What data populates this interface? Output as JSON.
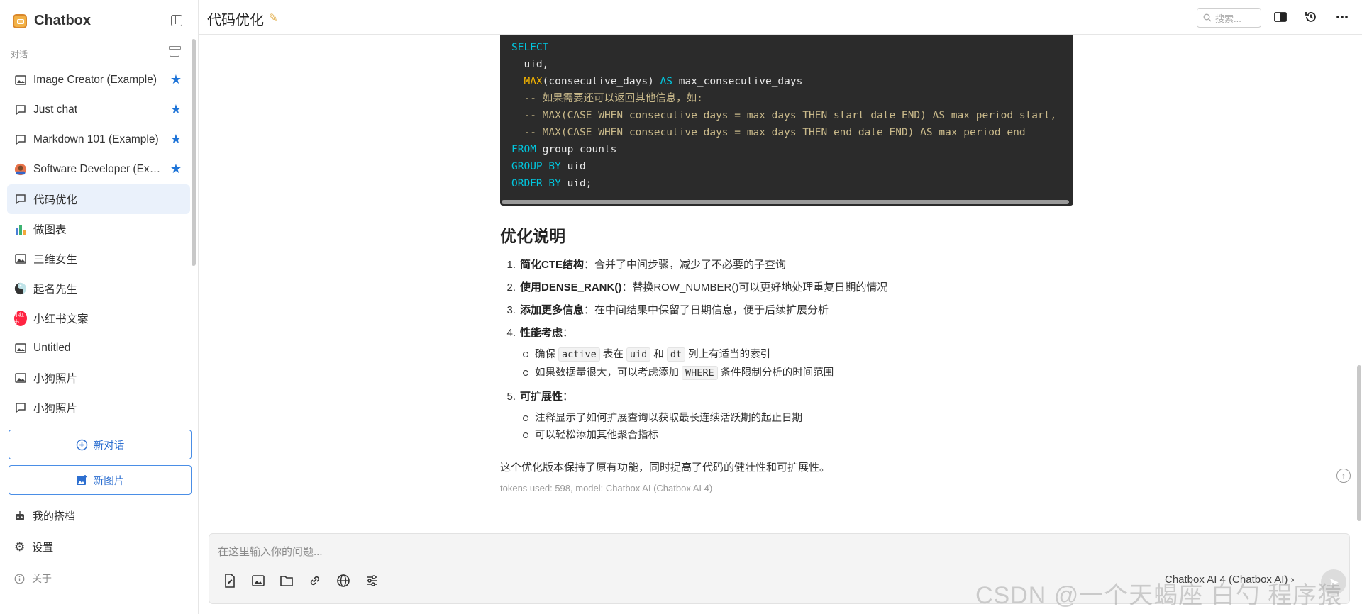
{
  "app": {
    "name": "Chatbox"
  },
  "sidebar": {
    "section_label": "对话",
    "items": [
      {
        "label": "Image Creator (Example)",
        "icon": "image-icon",
        "starred": true
      },
      {
        "label": "Just chat",
        "icon": "chat-icon",
        "starred": true
      },
      {
        "label": "Markdown 101 (Example)",
        "icon": "chat-icon",
        "starred": true
      },
      {
        "label": "Software Developer (Example)",
        "icon": "avatar-developer-icon",
        "starred": true
      },
      {
        "label": "代码优化",
        "icon": "chat-icon",
        "starred": false,
        "active": true
      },
      {
        "label": "做图表",
        "icon": "bar-chart-icon",
        "starred": false
      },
      {
        "label": "三维女生",
        "icon": "image-icon",
        "starred": false
      },
      {
        "label": "起名先生",
        "icon": "avatar-naming-icon",
        "starred": false
      },
      {
        "label": "小红书文案",
        "icon": "xiaohongshu-icon",
        "starred": false
      },
      {
        "label": "Untitled",
        "icon": "image-icon",
        "starred": false
      },
      {
        "label": "小狗照片",
        "icon": "image-icon",
        "starred": false
      },
      {
        "label": "小狗照片",
        "icon": "chat-icon",
        "starred": false
      }
    ],
    "new_chat": "新对话",
    "new_image": "新图片",
    "my_copilots": "我的搭档",
    "settings": "设置",
    "about": "关于",
    "xiaohongshu_badge": "小红书"
  },
  "header": {
    "title": "代码优化",
    "search_placeholder": "搜索..."
  },
  "code": {
    "lines": [
      [
        {
          "t": "SELECT",
          "c": "kw"
        }
      ],
      [
        {
          "t": "  uid,",
          "c": ""
        }
      ],
      [
        {
          "t": "  ",
          "c": ""
        },
        {
          "t": "MAX",
          "c": "fn"
        },
        {
          "t": "(consecutive_days) ",
          "c": ""
        },
        {
          "t": "AS",
          "c": "kw"
        },
        {
          "t": " max_consecutive_days",
          "c": ""
        }
      ],
      [
        {
          "t": "  -- 如果需要还可以返回其他信息，如:",
          "c": "cm"
        }
      ],
      [
        {
          "t": "  -- MAX(CASE WHEN consecutive_days = max_days THEN start_date END) AS max_period_start,",
          "c": "cm"
        }
      ],
      [
        {
          "t": "  -- MAX(CASE WHEN consecutive_days = max_days THEN end_date END) AS max_period_end",
          "c": "cm"
        }
      ],
      [
        {
          "t": "FROM",
          "c": "kw"
        },
        {
          "t": " group_counts",
          "c": ""
        }
      ],
      [
        {
          "t": "GROUP BY",
          "c": "kw"
        },
        {
          "t": " uid",
          "c": ""
        }
      ],
      [
        {
          "t": "ORDER BY",
          "c": "kw"
        },
        {
          "t": " uid;",
          "c": ""
        }
      ]
    ]
  },
  "message": {
    "section_title": "优化说明",
    "items": [
      {
        "num": "1.",
        "bold": "简化CTE结构",
        "text": "：合并了中间步骤，减少了不必要的子查询"
      },
      {
        "num": "2.",
        "bold": "使用DENSE_RANK()",
        "text": "：替换ROW_NUMBER()可以更好地处理重复日期的情况"
      },
      {
        "num": "3.",
        "bold": "添加更多信息",
        "text": "：在中间结果中保留了日期信息，便于后续扩展分析"
      },
      {
        "num": "4.",
        "bold": "性能考虑",
        "text": "："
      },
      {
        "num": "5.",
        "bold": "可扩展性",
        "text": "："
      }
    ],
    "perf": {
      "a1": "确保 ",
      "c1": "active",
      "a2": " 表在 ",
      "c2": "uid",
      "a3": " 和 ",
      "c3": "dt",
      "a4": " 列上有适当的索引",
      "b1": "如果数据量很大，可以考虑添加 ",
      "c4": "WHERE",
      "b2": " 条件限制分析的时间范围"
    },
    "ext": [
      "注释显示了如何扩展查询以获取最长连续活跃期的起止日期",
      "可以轻松添加其他聚合指标"
    ],
    "summary": "这个优化版本保持了原有功能，同时提高了代码的健壮性和可扩展性。",
    "meta": "tokens used: 598, model: Chatbox AI (Chatbox AI 4)"
  },
  "composer": {
    "placeholder": "在这里输入你的问题...",
    "model": "Chatbox AI 4 (Chatbox AI)",
    "model_suffix": "›"
  },
  "watermark": "CSDN @一个天蝎座 白勺 程序猿",
  "colors": {
    "accent": "#1e74d8",
    "code_bg": "#2b2b2b",
    "keyword": "#00c8e0",
    "function": "#f4b400",
    "comment": "#c9b98a"
  }
}
